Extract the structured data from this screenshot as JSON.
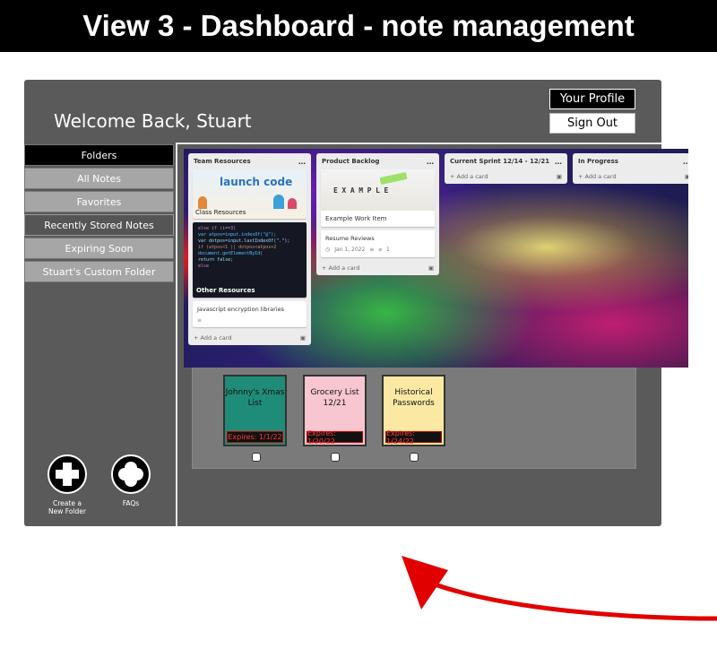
{
  "header": {
    "title": "View 3 - Dashboard - note management"
  },
  "app": {
    "welcome": "Welcome Back, Stuart",
    "buttons": {
      "profile": "Your Profile",
      "signout": "Sign Out"
    },
    "sidebar": {
      "items": [
        {
          "label": "Folders"
        },
        {
          "label": "All Notes"
        },
        {
          "label": "Favorites"
        },
        {
          "label": "Recently Stored Notes"
        },
        {
          "label": "Expiring Soon"
        },
        {
          "label": "Stuart's Custom Folder"
        }
      ],
      "create_folder": "Create a\nNew Folder",
      "faqs": "FAQs"
    },
    "notes": [
      {
        "title": "Johnny's Xmas List",
        "expires": "Expires: 1/1/22",
        "color": "#1e8c78"
      },
      {
        "title": "Grocery List 12/21",
        "expires": "Expires: 1/20/22",
        "color": "#f7c6d0"
      },
      {
        "title": "Historical Passwords",
        "expires": "Expires: 1/24/22",
        "color": "#fbe9a3"
      }
    ]
  },
  "board": {
    "lists": [
      {
        "title": "Team Resources",
        "card1_caption": "Class Resources",
        "logo_text": "launch code",
        "card2_caption": "Other Resources",
        "card3_text": "Javascript encryption libraries",
        "add_card": "+ Add a card"
      },
      {
        "title": "Product Backlog",
        "example_word": "EXAMPLE",
        "card1_caption": "Example Work Item",
        "card2_title": "Resume Reviews",
        "card2_date": "Jan 1, 2022",
        "card2_count": "1",
        "add_card": "+ Add a card"
      },
      {
        "title": "Current Sprint 12/14 - 12/21",
        "add_card": "+ Add a card"
      },
      {
        "title": "In Progress",
        "add_card": "+ Add a card"
      }
    ],
    "menu_icon": "…"
  },
  "colors": {
    "arrow": "#e10000",
    "expiry_text": "#ff3b3b"
  }
}
